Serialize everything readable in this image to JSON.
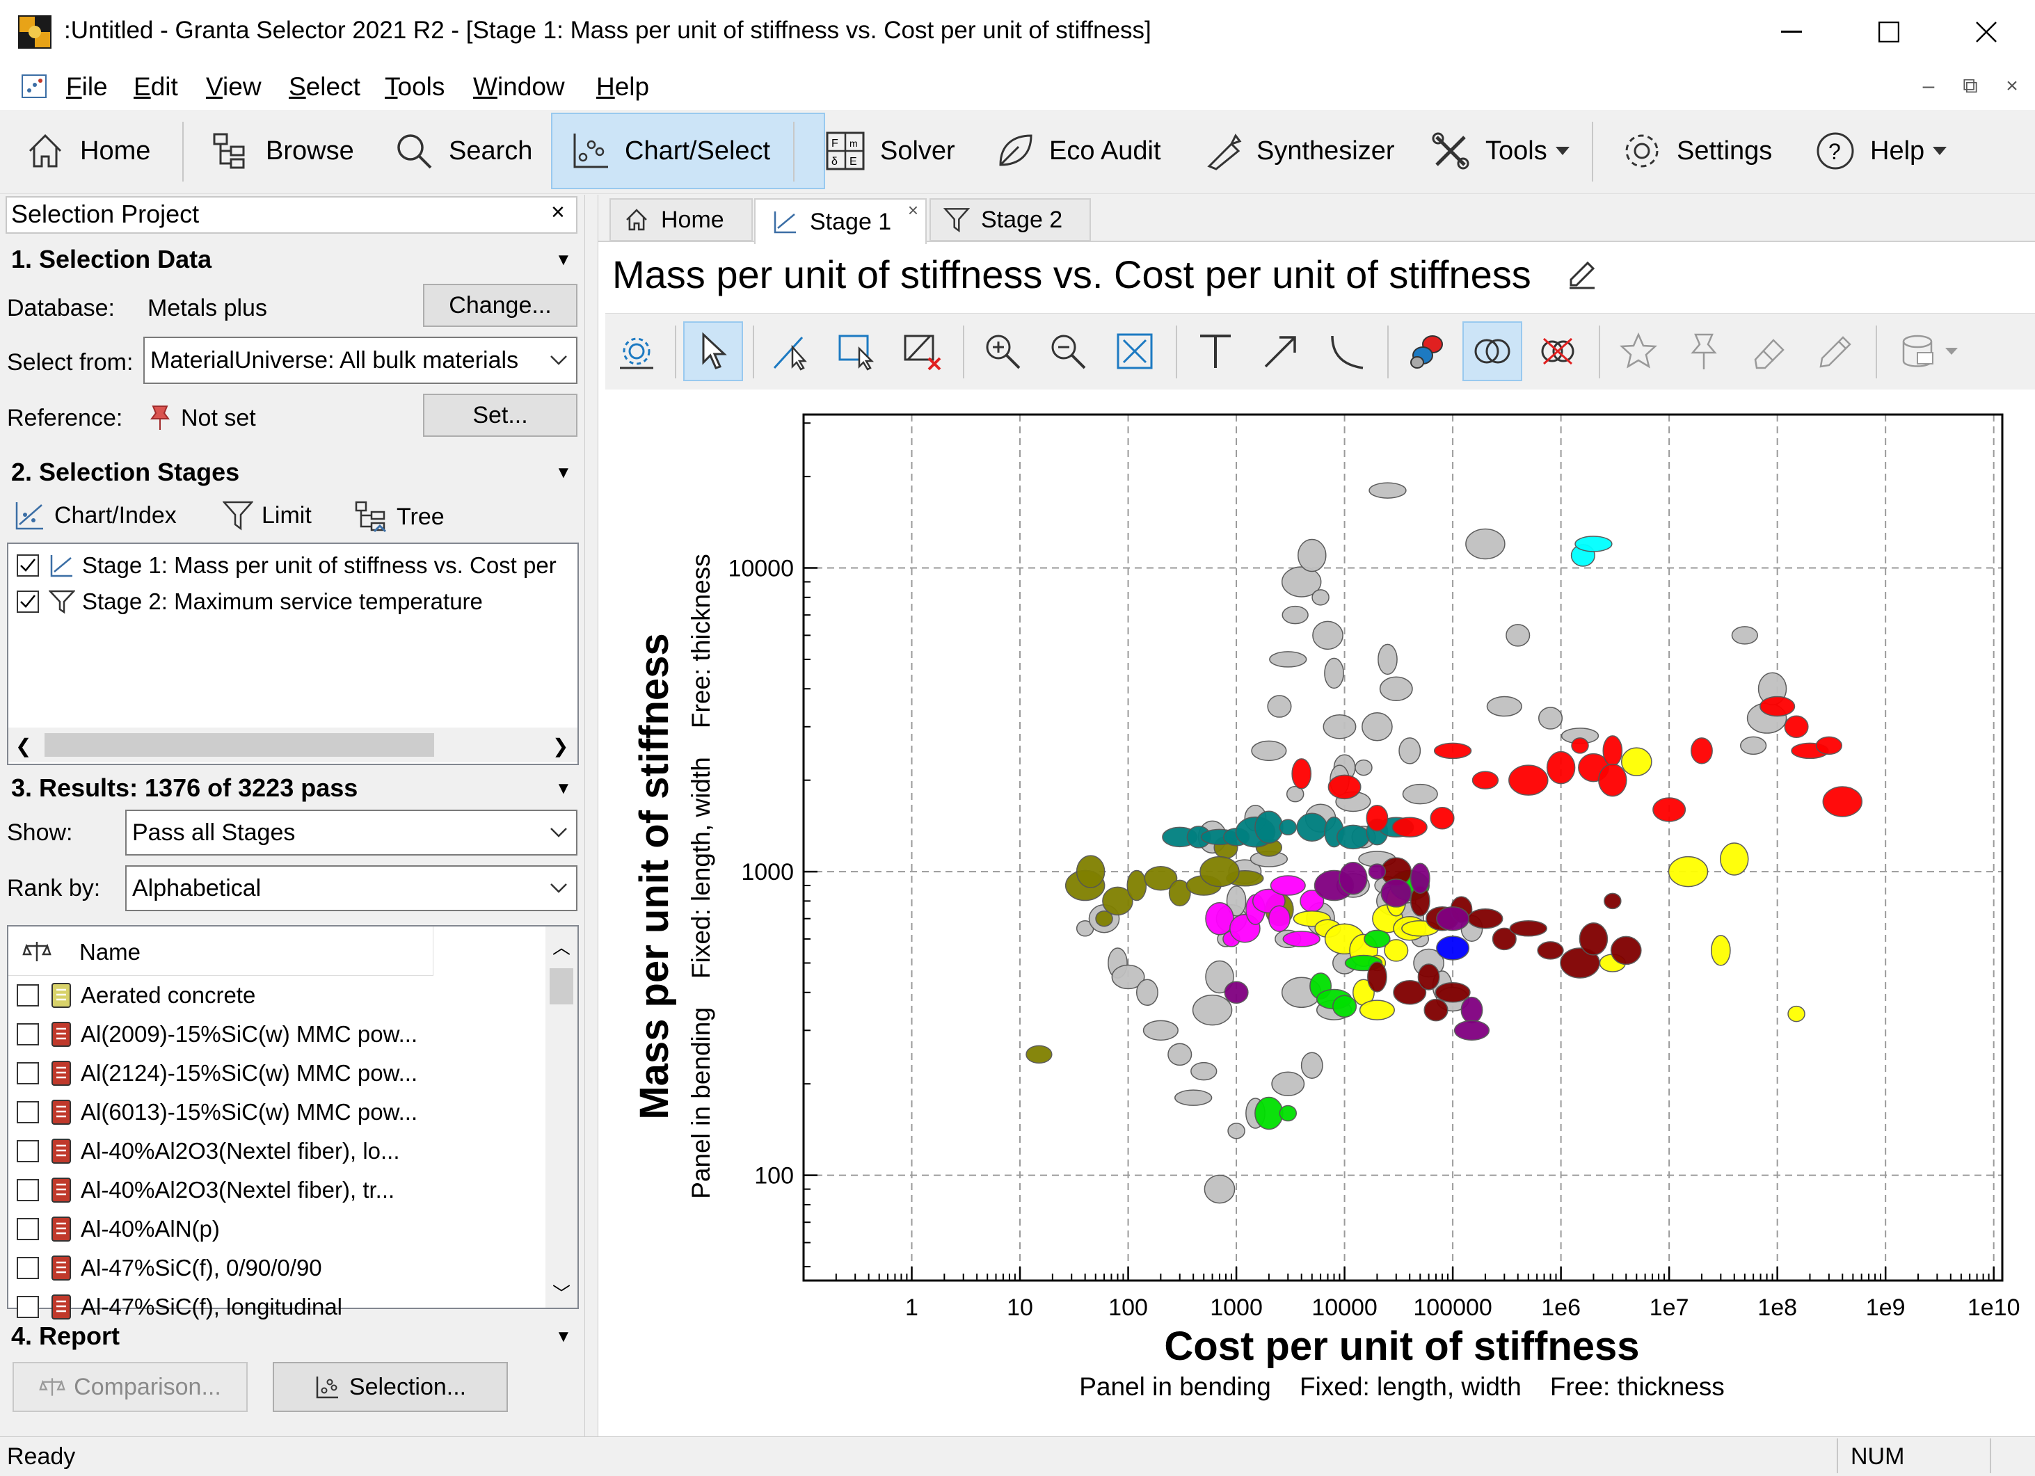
{
  "window": {
    "title": ":Untitled - Granta Selector 2021 R2 - [Stage 1: Mass per unit of stiffness vs. Cost per unit of stiffness]",
    "minimize_icon": "minimize-icon",
    "maximize_icon": "maximize-icon",
    "close_icon": "close-icon"
  },
  "menu": {
    "items": [
      "File",
      "Edit",
      "View",
      "Select",
      "Tools",
      "Window",
      "Help"
    ],
    "mdi_controls": [
      "–",
      "⧉",
      "×"
    ]
  },
  "toolbar": {
    "home": "Home",
    "browse": "Browse",
    "search": "Search",
    "chart_select": "Chart/Select",
    "solver": "Solver",
    "eco_audit": "Eco Audit",
    "synthesizer": "Synthesizer",
    "tools": "Tools",
    "settings": "Settings",
    "help": "Help"
  },
  "left_panel": {
    "header": "Selection Project",
    "selection_data": {
      "title": "1. Selection Data",
      "database_label": "Database:",
      "database_value": "Metals plus",
      "change_button": "Change...",
      "select_from_label": "Select from:",
      "select_from_value": "MaterialUniverse: All bulk materials",
      "reference_label": "Reference:",
      "reference_value": "Not set",
      "set_button": "Set..."
    },
    "selection_stages": {
      "title": "2. Selection Stages",
      "chart_index": "Chart/Index",
      "limit": "Limit",
      "tree": "Tree",
      "stages": [
        {
          "label": "Stage 1: Mass per unit of stiffness vs. Cost per",
          "checked": true,
          "icon": "chart-stage-icon"
        },
        {
          "label": "Stage 2: Maximum service temperature",
          "checked": true,
          "icon": "filter-stage-icon"
        }
      ]
    },
    "results": {
      "title": "3. Results: 1376 of 3223 pass",
      "show_label": "Show:",
      "show_value": "Pass all Stages",
      "rank_label": "Rank by:",
      "rank_value": "Alphabetical",
      "column_name": "Name",
      "items": [
        {
          "name": "Aerated concrete",
          "color": "#d8d26a"
        },
        {
          "name": "Al(2009)-15%SiC(w) MMC pow...",
          "color": "#c0392b"
        },
        {
          "name": "Al(2124)-15%SiC(w) MMC pow...",
          "color": "#c0392b"
        },
        {
          "name": "Al(6013)-15%SiC(w) MMC pow...",
          "color": "#c0392b"
        },
        {
          "name": "Al-40%Al2O3(Nextel fiber), lo...",
          "color": "#c0392b"
        },
        {
          "name": "Al-40%Al2O3(Nextel fiber), tr...",
          "color": "#c0392b"
        },
        {
          "name": "Al-40%AlN(p)",
          "color": "#c0392b"
        },
        {
          "name": "Al-47%SiC(f), 0/90/0/90",
          "color": "#c0392b"
        },
        {
          "name": "Al-47%SiC(f), longitudinal",
          "color": "#c0392b"
        }
      ]
    },
    "report": {
      "title": "4. Report",
      "comparison_button": "Comparison...",
      "selection_button": "Selection..."
    }
  },
  "tabs": [
    {
      "label": "Home",
      "icon": "home-icon"
    },
    {
      "label": "Stage 1",
      "icon": "chart-icon",
      "active": true
    },
    {
      "label": "Stage 2",
      "icon": "filter-icon"
    }
  ],
  "chart_title": "Mass per unit of stiffness vs. Cost per unit of stiffness",
  "chart_toolbar_icons": [
    "chart-settings-icon",
    "pointer-icon",
    "line-select-icon",
    "box-select-icon",
    "delete-selection-icon",
    "zoom-in-icon",
    "zoom-out-icon",
    "zoom-fit-icon",
    "text-icon",
    "arrow-icon",
    "curve-icon",
    "color-by-icon",
    "overlap-icon",
    "hide-failed-icon",
    "star-icon",
    "pin-icon",
    "eraser-icon",
    "pencil-icon",
    "database-icon"
  ],
  "status": {
    "left": "Ready",
    "num": "NUM"
  },
  "chart_data": {
    "type": "scatter",
    "title": "",
    "xlabel": "Cost per unit of stiffness",
    "xsublabel": "Panel in bending    Fixed: length, width    Free: thickness",
    "ylabel": "Mass per unit of stiffness",
    "ysublabel": "Panel in bending    Fixed: length, width    Free: thickness",
    "x_scale": "log",
    "y_scale": "log",
    "xlim": [
      0.1,
      12000000000.0
    ],
    "ylim": [
      45,
      32000
    ],
    "x_ticks": [
      {
        "value": 1,
        "label": "1"
      },
      {
        "value": 10,
        "label": "10"
      },
      {
        "value": 100,
        "label": "100"
      },
      {
        "value": 1000,
        "label": "1000"
      },
      {
        "value": 10000,
        "label": "10000"
      },
      {
        "value": 100000,
        "label": "100000"
      },
      {
        "value": 1000000,
        "label": "1e6"
      },
      {
        "value": 10000000,
        "label": "1e7"
      },
      {
        "value": 100000000,
        "label": "1e8"
      },
      {
        "value": 1000000000,
        "label": "1e9"
      },
      {
        "value": 10000000000,
        "label": "1e10"
      }
    ],
    "y_ticks": [
      {
        "value": 100,
        "label": "100"
      },
      {
        "value": 1000,
        "label": "1000"
      },
      {
        "value": 10000,
        "label": "10000"
      }
    ],
    "grid": true,
    "series": [
      {
        "color": "#c0c0c0",
        "points": [
          [
            40,
            650
          ],
          [
            60,
            700
          ],
          [
            80,
            500
          ],
          [
            100,
            450
          ],
          [
            150,
            400
          ],
          [
            200,
            300
          ],
          [
            300,
            250
          ],
          [
            400,
            180
          ],
          [
            500,
            220
          ],
          [
            600,
            350
          ],
          [
            700,
            450
          ],
          [
            800,
            600
          ],
          [
            900,
            700
          ],
          [
            1000,
            800
          ],
          [
            1200,
            1000
          ],
          [
            1500,
            1500
          ],
          [
            2000,
            2500
          ],
          [
            2500,
            3500
          ],
          [
            3000,
            5000
          ],
          [
            3500,
            7000
          ],
          [
            4000,
            9000
          ],
          [
            5000,
            11000
          ],
          [
            6000,
            8000
          ],
          [
            7000,
            6000
          ],
          [
            8000,
            4500
          ],
          [
            9000,
            3000
          ],
          [
            10000,
            2200
          ],
          [
            12000,
            1700
          ],
          [
            15000,
            1300
          ],
          [
            20000,
            1100
          ],
          [
            25000,
            900
          ],
          [
            30000,
            800
          ],
          [
            40000,
            700
          ],
          [
            50000,
            600
          ],
          [
            60000,
            500
          ],
          [
            80000,
            420
          ],
          [
            100000,
            380
          ],
          [
            150000,
            650
          ],
          [
            300000,
            3500
          ],
          [
            800000,
            3200
          ],
          [
            1500000,
            2800
          ],
          [
            60000000,
            2600
          ],
          [
            80000000,
            3200
          ],
          [
            90000000,
            4000
          ],
          [
            1000,
            140
          ],
          [
            700,
            90
          ],
          [
            1500,
            160
          ],
          [
            3000,
            200
          ],
          [
            5000,
            230
          ],
          [
            8000,
            350
          ],
          [
            10000,
            500
          ],
          [
            2000,
            1100
          ],
          [
            3000,
            600
          ],
          [
            4000,
            400
          ],
          [
            6000,
            700
          ],
          [
            15000,
            2200
          ],
          [
            20000,
            3000
          ],
          [
            25000,
            5000
          ],
          [
            30000,
            4000
          ],
          [
            40000,
            2500
          ],
          [
            50000,
            1800
          ],
          [
            400000,
            6000
          ],
          [
            25000,
            18000
          ],
          [
            50000000,
            6000
          ],
          [
            200000,
            12000
          ],
          [
            600,
            1300
          ],
          [
            3500,
            1800
          ],
          [
            6000,
            1500
          ],
          [
            9000,
            2000
          ],
          [
            12000,
            900
          ]
        ]
      },
      {
        "color": "#808000",
        "points": [
          [
            15,
            250
          ],
          [
            40,
            900
          ],
          [
            45,
            1000
          ],
          [
            60,
            700
          ],
          [
            80,
            800
          ],
          [
            120,
            900
          ],
          [
            200,
            950
          ],
          [
            300,
            850
          ],
          [
            500,
            900
          ],
          [
            800,
            1200
          ],
          [
            1200,
            950
          ],
          [
            2000,
            1200
          ],
          [
            700,
            1000
          ],
          [
            2500,
            750
          ]
        ]
      },
      {
        "color": "#008080",
        "points": [
          [
            300,
            1300
          ],
          [
            450,
            1300
          ],
          [
            700,
            1300
          ],
          [
            1000,
            1300
          ],
          [
            1500,
            1350
          ],
          [
            2000,
            1400
          ],
          [
            3000,
            1400
          ],
          [
            5000,
            1400
          ],
          [
            8000,
            1350
          ],
          [
            12000,
            1300
          ],
          [
            20000,
            1350
          ],
          [
            30000,
            1400
          ]
        ]
      },
      {
        "color": "#ff0000",
        "points": [
          [
            4000,
            2100
          ],
          [
            10000,
            1900
          ],
          [
            20000,
            1500
          ],
          [
            40000,
            1400
          ],
          [
            80000,
            1500
          ],
          [
            100000,
            2500
          ],
          [
            200000,
            2000
          ],
          [
            500000,
            2000
          ],
          [
            1000000,
            2200
          ],
          [
            1500000,
            2600
          ],
          [
            2000000,
            2200
          ],
          [
            3000000,
            2500
          ],
          [
            10000000,
            1600
          ],
          [
            20000000,
            2500
          ],
          [
            100000000,
            3500
          ],
          [
            150000000,
            3000
          ],
          [
            200000000,
            2500
          ],
          [
            300000000,
            2600
          ],
          [
            400000000,
            1700
          ],
          [
            3000000,
            2000
          ]
        ]
      },
      {
        "color": "#ff00ff",
        "points": [
          [
            700,
            700
          ],
          [
            900,
            600
          ],
          [
            1200,
            650
          ],
          [
            1500,
            750
          ],
          [
            2000,
            800
          ],
          [
            2500,
            700
          ],
          [
            3000,
            900
          ],
          [
            5000,
            800
          ],
          [
            4000,
            600
          ]
        ]
      },
      {
        "color": "#ffff00",
        "points": [
          [
            5000,
            700
          ],
          [
            7000,
            650
          ],
          [
            10000,
            600
          ],
          [
            15000,
            550
          ],
          [
            20000,
            500
          ],
          [
            25000,
            700
          ],
          [
            30000,
            800
          ],
          [
            40000,
            650
          ],
          [
            15000,
            400
          ],
          [
            20000,
            350
          ],
          [
            30000,
            550
          ],
          [
            50000,
            650
          ],
          [
            3000000,
            500
          ],
          [
            15000000,
            1000
          ],
          [
            40000000,
            1100
          ],
          [
            150000000,
            340
          ],
          [
            5000000,
            2300
          ],
          [
            30000000,
            550
          ]
        ]
      },
      {
        "color": "#00e000",
        "points": [
          [
            6000,
            420
          ],
          [
            8000,
            380
          ],
          [
            10000,
            360
          ],
          [
            15000,
            500
          ],
          [
            20000,
            600
          ],
          [
            40000,
            900
          ],
          [
            2000,
            160
          ],
          [
            3000,
            160
          ]
        ]
      },
      {
        "color": "#800000",
        "points": [
          [
            30000,
            1000
          ],
          [
            50000,
            800
          ],
          [
            80000,
            700
          ],
          [
            120000,
            750
          ],
          [
            200000,
            700
          ],
          [
            300000,
            600
          ],
          [
            500000,
            650
          ],
          [
            800000,
            550
          ],
          [
            1500000,
            500
          ],
          [
            2000000,
            600
          ],
          [
            3000000,
            800
          ],
          [
            4000000,
            550
          ],
          [
            20000,
            450
          ],
          [
            40000,
            400
          ],
          [
            60000,
            450
          ],
          [
            100000,
            400
          ],
          [
            70000,
            350
          ]
        ]
      },
      {
        "color": "#800080",
        "points": [
          [
            8000,
            900
          ],
          [
            12000,
            950
          ],
          [
            20000,
            1000
          ],
          [
            30000,
            850
          ],
          [
            50000,
            950
          ],
          [
            100000,
            700
          ],
          [
            150000,
            350
          ],
          [
            150000,
            300
          ],
          [
            1000,
            400
          ]
        ]
      },
      {
        "color": "#00ffff",
        "points": [
          [
            1600000,
            11000
          ],
          [
            2000000,
            12000
          ]
        ]
      },
      {
        "color": "#0000ff",
        "points": [
          [
            100000,
            560
          ]
        ]
      }
    ]
  }
}
